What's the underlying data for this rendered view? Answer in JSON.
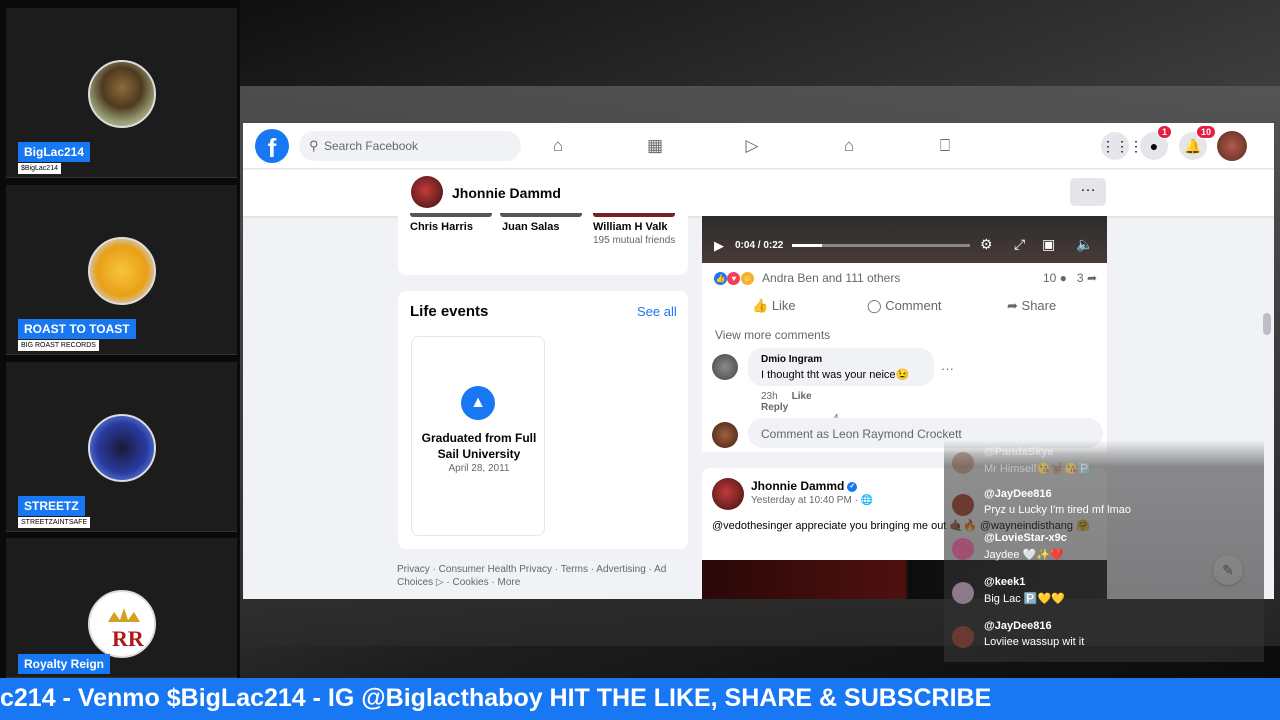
{
  "participants": [
    {
      "name": "BigLac214",
      "handle": "$BigLac214"
    },
    {
      "name": "ROAST TO TOAST",
      "handle": "BIG ROAST RECORDS"
    },
    {
      "name": "STREETZ",
      "handle": "STREETZAINTSAFE"
    },
    {
      "name": "Royalty Reign"
    }
  ],
  "facebook": {
    "logo": "f",
    "search_placeholder": "Search Facebook",
    "nav_icons": [
      "home-icon",
      "pages-icon",
      "watch-icon",
      "marketplace-icon",
      "gaming-icon"
    ],
    "messenger_badge": "1",
    "notifications_badge": "10",
    "profile_name": "Jhonnie Dammd",
    "more_label": "···",
    "friends": [
      {
        "name": "Chris Harris",
        "sub": ""
      },
      {
        "name": "Juan Salas",
        "sub": ""
      },
      {
        "name": "William H Valk",
        "sub": "195 mutual friends"
      }
    ],
    "life_events": {
      "title": "Life events",
      "see_all": "See all",
      "event_title": "Graduated from Full Sail University",
      "event_date": "April 28, 2011"
    },
    "footer": "Privacy · Consumer Health Privacy · Terms · Advertising · Ad Choices ▷ · Cookies · More",
    "post": {
      "video_time": "0:04 / 0:22",
      "reactions_text": "Andra Ben and 111 others",
      "comments_count": "10",
      "shares_count": "3",
      "like_label": "Like",
      "comment_label": "Comment",
      "share_label": "Share",
      "view_more": "View more comments",
      "comment": {
        "author": "Dmio Ingram",
        "text": "I thought tht was your neice😉",
        "time": "23h",
        "like": "Like",
        "reply": "Reply",
        "reaction_count": "4😮"
      },
      "write_placeholder": "Comment as Leon Raymond Crockett"
    },
    "post2": {
      "author": "Jhonnie Dammd",
      "time": "Yesterday at 10:40 PM · 🌐",
      "text": "@vedothesinger appreciate you bringing me out 🤙🏾🔥 @wayneindisthang 🤗"
    }
  },
  "chat": [
    {
      "name": "@PandaSkye",
      "text": "Mr Himself😘🤘🏾😘🅿️",
      "color": "#7a4a3a"
    },
    {
      "name": "@JayDee816",
      "text": "Pryz u Lucky I'm tired mf lmao",
      "color": "#6a3a30"
    },
    {
      "name": "@LovieStar-x9c",
      "text": "Jaydee 🤍✨❤️",
      "color": "#a05070"
    },
    {
      "name": "@keek1",
      "text": "Big Lac 🅿️💛💛",
      "color": "#8a7a8a"
    },
    {
      "name": "@JayDee816",
      "text": "Loviiee wassup wit it",
      "color": "#6a3a30"
    }
  ],
  "ticker": "c214 - Venmo $BigLac214 - IG @Biglacthaboy HIT THE LIKE, SHARE & SUBSCRIBE",
  "colors": {
    "accent": "#1877f2",
    "badge": "#e41e3f"
  }
}
